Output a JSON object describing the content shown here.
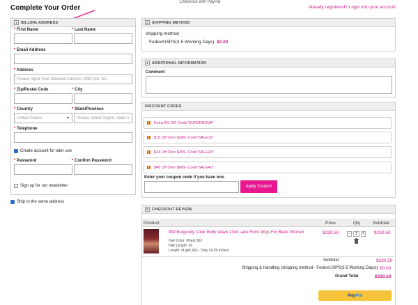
{
  "header": {
    "title": "Complete Your Order",
    "paypal_image_alt": "Checkout with PayPal",
    "login_link": "Already registered? Login into your account"
  },
  "billing": {
    "step": "1",
    "heading": "BILLING ADDRESS",
    "first_name_label": "First Name",
    "last_name_label": "Last Name",
    "email_label": "Email Address",
    "address_label": "Address",
    "address_placeholder": "Please Input Your Detailed Address With Apt. No.",
    "zip_label": "Zip/Postal Code",
    "city_label": "City",
    "country_label": "Country",
    "country_value": "United States.",
    "state_label": "State/Province",
    "state_placeholder": "Please select region, state o",
    "telephone_label": "Telephone",
    "create_account_label": "Create account for later use",
    "password_label": "Password",
    "confirm_password_label": "Confirm Password",
    "newsletter_label": "Sign up for our newsletter"
  },
  "ship_same_label": "Ship to the same address",
  "shipping": {
    "step": "2",
    "heading": "SHIPPING METHOD",
    "method_title": "shipping method",
    "method_name": "Fedex/USPS(3-5 Working Days)",
    "method_price": "$0.00"
  },
  "additional": {
    "step": "4",
    "heading": "ADDITIONAL INFORMATION",
    "comment_label": "Comment"
  },
  "discount": {
    "heading": "DISCOUNT CODES",
    "coupons": [
      "Extra 5% Off- Code\"SUPERNOVA\"",
      "$15 Off Over $249- Code\"SALE15\"",
      "$24 Off Over $399- Code\"SALE24\"",
      "$40 Off Over $669- Code\"SALE40\""
    ],
    "enter_label": "Enter your coupon code if you have one.",
    "apply_label": "Apply Coupon"
  },
  "review": {
    "step": "5",
    "heading": "CHECKOUT REVIEW",
    "columns": [
      "Product",
      "Price",
      "Qty",
      "Subtotal"
    ],
    "item": {
      "name": "99J Burgundy Color Body Wave 13x4 Lace Front Wigs For Black Women",
      "attr1": "Hair Color:  #Dark 99J",
      "attr2": "Hair Length:  16",
      "attr3": "Length:  #Light 99J-- Only 16-26 Inches",
      "price": "$230.50",
      "qty": "1",
      "subtotal": "$230.50"
    },
    "subtotal_label": "Subtotal",
    "subtotal_value": "$230.50",
    "shipping_label": "Shipping & Handling (shipping method - Fedex/USPS(3-5 Working Days))",
    "shipping_value": "$0.00",
    "grand_label": "Grand Total",
    "grand_value": "$230.50",
    "paypal_label_a": "Pay",
    "paypal_label_b": "Pal"
  },
  "colors": {
    "accent": "#d21b8c",
    "button": "#e8178f",
    "paypal": "#f7c33a"
  }
}
